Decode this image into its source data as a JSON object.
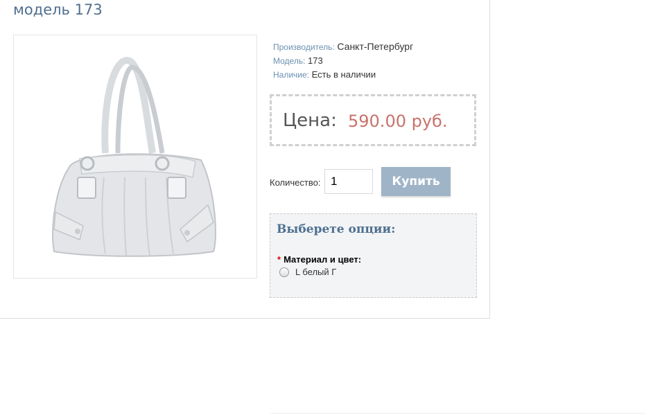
{
  "product": {
    "title": "модель 173",
    "image_alt": "white handbag"
  },
  "info": {
    "manufacturer_label": "Производитель:",
    "manufacturer_value": "Санкт-Петербург",
    "model_label": "Модель:",
    "model_value": "173",
    "availability_label": "Наличие:",
    "availability_value": "Есть в наличии"
  },
  "price": {
    "label": "Цена:",
    "value": "590.00 руб."
  },
  "purchase": {
    "quantity_label": "Количество:",
    "quantity_value": "1",
    "buy_label": "Купить"
  },
  "options": {
    "title": "Выберете опции:",
    "required_mark": "*",
    "field_label": "Материал и цвет:",
    "choice_label": "L белый Г"
  },
  "colors": {
    "title": "#4f6f8f",
    "label_blue": "#6a8fb0",
    "price_red": "#c8726c",
    "button_bg": "#a0b4c8",
    "options_bg": "#f2f4f6"
  }
}
